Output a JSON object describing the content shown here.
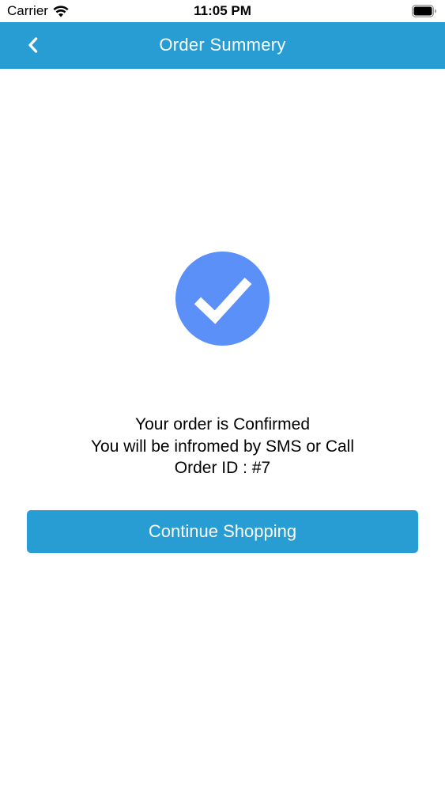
{
  "status_bar": {
    "carrier": "Carrier",
    "time": "11:05 PM",
    "icons": [
      "wifi-icon",
      "battery-icon"
    ]
  },
  "nav": {
    "title": "Order Summery",
    "back_icon": "chevron-left-icon",
    "color": "#279dd4"
  },
  "confirmation": {
    "icon": "checkmark-icon",
    "badge_color": "#5b90f9",
    "line1": "Your order is Confirmed",
    "line2": "You will be infromed by SMS or Call",
    "line3": "Order ID : #7"
  },
  "actions": {
    "continue_label": "Continue Shopping",
    "button_color": "#279dd4"
  }
}
